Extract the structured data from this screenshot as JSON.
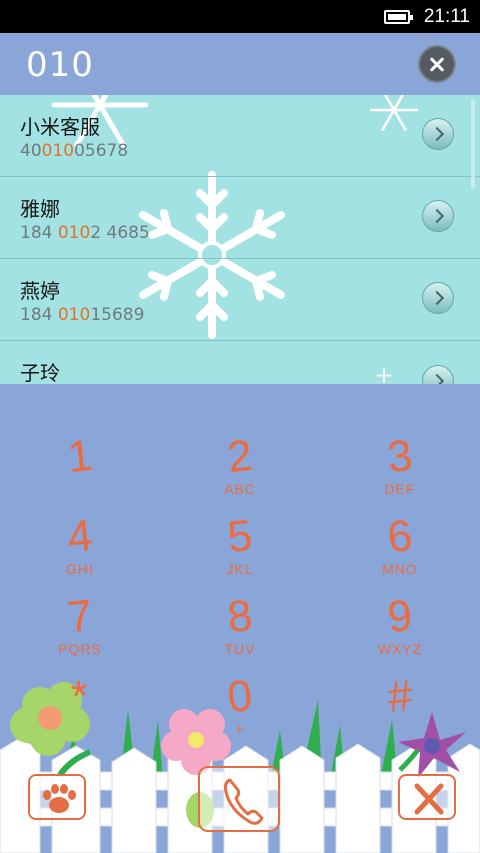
{
  "status_bar": {
    "time": "21:11"
  },
  "number_bar": {
    "dialed": "010"
  },
  "results": [
    {
      "name": "小米客服",
      "number_before": "40",
      "number_match": "010",
      "number_after": "05678"
    },
    {
      "name": "雅娜",
      "number_before": "184 ",
      "number_match": "010",
      "number_after": "2 4685"
    },
    {
      "name": "燕婷",
      "number_before": "184 ",
      "number_match": "010",
      "number_after": "15689"
    },
    {
      "name": "子玲",
      "number_before": "",
      "number_match": "",
      "number_after": ""
    }
  ],
  "keypad": [
    {
      "digit": "1",
      "letters": ""
    },
    {
      "digit": "2",
      "letters": "ABC"
    },
    {
      "digit": "3",
      "letters": "DEF"
    },
    {
      "digit": "4",
      "letters": "GHI"
    },
    {
      "digit": "5",
      "letters": "JKL"
    },
    {
      "digit": "6",
      "letters": "MNO"
    },
    {
      "digit": "7",
      "letters": "PQRS"
    },
    {
      "digit": "8",
      "letters": "TUV"
    },
    {
      "digit": "9",
      "letters": "WXYZ"
    },
    {
      "digit": "*",
      "letters": ""
    },
    {
      "digit": "0",
      "letters": "+"
    },
    {
      "digit": "#",
      "letters": ""
    }
  ],
  "colors": {
    "accent": "#ec6a3f",
    "match_highlight": "#e0722a",
    "list_background": "#a3e2e2",
    "keypad_background": "#8aa6d9"
  },
  "icons": {
    "contacts": "paw-icon",
    "call": "phone-icon",
    "delete": "backspace-x-icon"
  }
}
